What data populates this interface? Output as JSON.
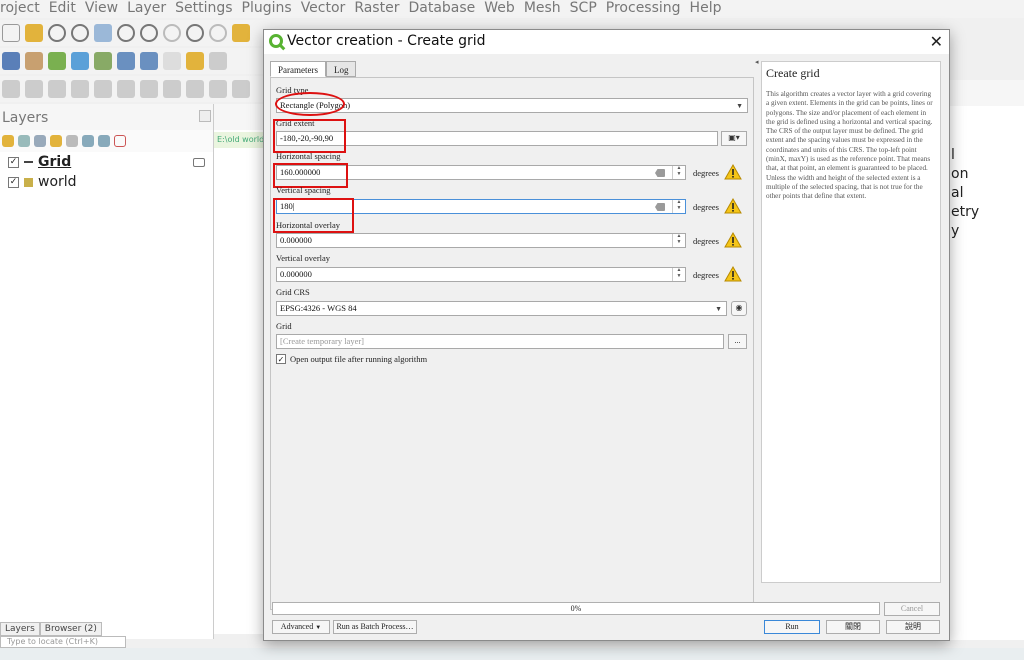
{
  "app": {
    "menu": [
      "roject",
      "Edit",
      "View",
      "Layer",
      "Settings",
      "Plugins",
      "Vector",
      "Raster",
      "Database",
      "Web",
      "Mesh",
      "SCP",
      "Processing",
      "Help"
    ],
    "layers_panel": {
      "title": "Layers",
      "layers": [
        {
          "name": "Grid",
          "checked": true,
          "symbol": "line"
        },
        {
          "name": "world",
          "checked": true,
          "symbol": "fill"
        }
      ],
      "tabs": [
        "Layers",
        "Browser (2)"
      ],
      "locator_placeholder": "Type to locate (Ctrl+K)"
    },
    "path_snippet": "E:\\old world.s",
    "right_fragments": [
      "l",
      "on",
      "al",
      "etry",
      "y"
    ]
  },
  "dialog": {
    "title": "Vector creation - Create grid",
    "tabs": [
      "Parameters",
      "Log"
    ],
    "active_tab": "Parameters",
    "params": {
      "grid_type_label": "Grid type",
      "grid_type_value": "Rectangle (Polygon)",
      "grid_extent_label": "Grid extent",
      "grid_extent_value": "-180,-20,-90,90",
      "h_spacing_label": "Horizontal spacing",
      "h_spacing_value": "160.000000",
      "v_spacing_label": "Vertical spacing",
      "v_spacing_value": "180",
      "h_overlay_label": "Horizontal overlay",
      "h_overlay_value": "0.000000",
      "v_overlay_label": "Vertical overlay",
      "v_overlay_value": "0.000000",
      "unit": "degrees",
      "crs_label": "Grid CRS",
      "crs_value": "EPSG:4326 - WGS 84",
      "output_label": "Grid",
      "output_placeholder": "[Create temporary layer]",
      "output_button": "...",
      "open_output_label": "Open output file after running algorithm",
      "open_output_checked": true
    },
    "help": {
      "title": "Create grid",
      "text": "This algorithm creates a vector layer with a grid covering a given extent. Elements in the grid can be points, lines or polygons. The size and/or placement of each element in the grid is defined using a horizontal and vertical spacing. The CRS of the output layer must be defined. The grid extent and the spacing values must be expressed in the coordinates and units of this CRS. The top-left point (minX, maxY) is used as the reference point. That means that, at that point, an element is guaranteed to be placed. Unless the width and height of the selected extent is a multiple of the selected spacing, that is not true for the other points that define that extent."
    },
    "progress": {
      "text": "0%",
      "value": 0
    },
    "buttons": {
      "cancel": "Cancel",
      "advanced": "Advanced",
      "batch": "Run as Batch Process…",
      "run": "Run",
      "close": "關閉",
      "help": "說明"
    }
  },
  "colors": {
    "accent": "#3a88d8",
    "annotation": "#dd1111",
    "warning": "#f5c518",
    "qgis_green": "#58b332"
  }
}
